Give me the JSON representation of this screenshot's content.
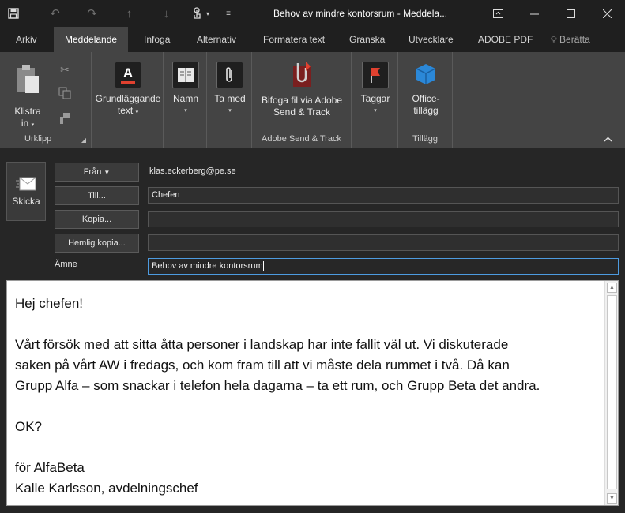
{
  "window": {
    "title": "Behov av mindre kontorsrum  -  Meddela...",
    "touch_mode_label": "▾"
  },
  "tabs": [
    {
      "label": "Arkiv"
    },
    {
      "label": "Meddelande"
    },
    {
      "label": "Infoga"
    },
    {
      "label": "Alternativ"
    },
    {
      "label": "Formatera text"
    },
    {
      "label": "Granska"
    },
    {
      "label": "Utvecklare"
    },
    {
      "label": "ADOBE PDF"
    },
    {
      "label": "Berätta"
    }
  ],
  "ribbon": {
    "clipboard": {
      "paste_line1": "Klistra",
      "paste_line2": "in",
      "group_label": "Urklipp"
    },
    "basic_text": {
      "line1": "Grundläggande",
      "line2": "text"
    },
    "names": {
      "label": "Namn"
    },
    "include": {
      "label": "Ta med"
    },
    "adobe": {
      "line1": "Bifoga fil via Adobe",
      "line2": "Send & Track",
      "group_label": "Adobe Send & Track"
    },
    "tags": {
      "label": "Taggar"
    },
    "addins": {
      "line1": "Office-",
      "line2": "tillägg",
      "group_label": "Tillägg"
    },
    "accent_colors": {
      "flag": "#e0412f",
      "office_blue": "#2b88d8",
      "font_red": "#e0412f"
    }
  },
  "header": {
    "send_label": "Skicka",
    "from_label": "Från",
    "from_value": "klas.eckerberg@pe.se",
    "to_label": "Till...",
    "to_value": "Chefen",
    "cc_label": "Kopia...",
    "cc_value": "",
    "bcc_label": "Hemlig kopia...",
    "bcc_value": "",
    "subject_label": "Ämne",
    "subject_value": "Behov av mindre kontorsrum"
  },
  "message": {
    "lines": [
      "Hej chefen!",
      "",
      "Vårt försök med att sitta åtta personer i landskap har inte fallit väl ut. Vi diskuterade",
      "saken på vårt AW i fredags, och kom fram till att vi måste dela rummet i två. Då kan",
      "Grupp Alfa – som snackar i telefon hela dagarna – ta ett rum, och Grupp Beta det andra.",
      "",
      "OK?",
      "",
      "för AlfaBeta",
      "Kalle Karlsson, avdelningschef"
    ]
  }
}
